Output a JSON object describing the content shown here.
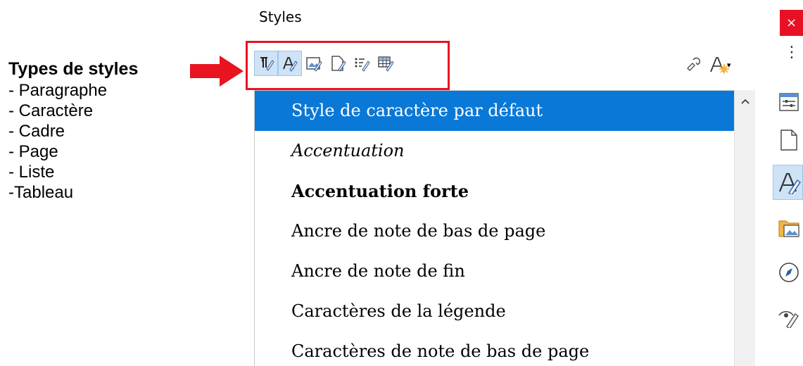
{
  "annotation": {
    "title": "Types de styles",
    "items": [
      "- Paragraphe",
      "- Caractère",
      "- Cadre",
      "- Page",
      "- Liste",
      "-Tableau"
    ]
  },
  "panel": {
    "title": "Styles",
    "close_label": "×"
  },
  "toolbar": {
    "style_types": [
      {
        "icon": "paragraph-styles-icon",
        "active": true
      },
      {
        "icon": "character-styles-icon",
        "active": true
      },
      {
        "icon": "frame-styles-icon",
        "active": false
      },
      {
        "icon": "page-styles-icon",
        "active": false
      },
      {
        "icon": "list-styles-icon",
        "active": false
      },
      {
        "icon": "table-styles-icon",
        "active": false
      }
    ],
    "fill_format_icon": "fill-format-mode-icon",
    "new_style_icon": "styles-actions-icon",
    "dropdown_caret": "▾"
  },
  "list": {
    "items": [
      {
        "label": "Style de caractère par défaut",
        "selected": true,
        "style": "normal"
      },
      {
        "label": "Accentuation",
        "selected": false,
        "style": "italic"
      },
      {
        "label": "Accentuation forte",
        "selected": false,
        "style": "bold"
      },
      {
        "label": "Ancre de note de bas de page",
        "selected": false,
        "style": "normal"
      },
      {
        "label": "Ancre de note de fin",
        "selected": false,
        "style": "normal"
      },
      {
        "label": "Caractères de la légende",
        "selected": false,
        "style": "normal"
      },
      {
        "label": "Caractères de note de bas de page",
        "selected": false,
        "style": "normal"
      }
    ]
  },
  "sidebar_deck": [
    {
      "icon": "properties-icon",
      "active": false
    },
    {
      "icon": "page-icon",
      "active": false
    },
    {
      "icon": "styles-icon",
      "active": true
    },
    {
      "icon": "gallery-icon",
      "active": false
    },
    {
      "icon": "navigator-icon",
      "active": false
    },
    {
      "icon": "style-inspector-icon",
      "active": false
    }
  ],
  "colors": {
    "selection": "#0a78d7",
    "highlight_box": "#e8141f",
    "active_button": "#cfe3f6",
    "close_button": "#e81123"
  }
}
